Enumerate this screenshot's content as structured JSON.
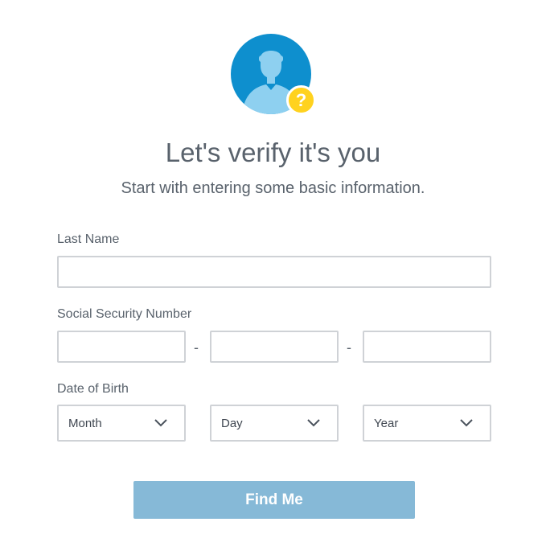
{
  "header": {
    "avatar_icon": "user-silhouette-icon",
    "help_badge": "?",
    "title": "Let's verify it's you",
    "subtitle": "Start with entering some basic information."
  },
  "form": {
    "last_name": {
      "label": "Last Name",
      "value": "",
      "placeholder": ""
    },
    "ssn": {
      "label": "Social Security Number",
      "separator": "-",
      "part1": "",
      "part2": "",
      "part3": ""
    },
    "dob": {
      "label": "Date of Birth",
      "month": "Month",
      "day": "Day",
      "year": "Year",
      "chevron_icon": "chevron-down-icon"
    },
    "submit_label": "Find Me"
  },
  "colors": {
    "avatar_bg": "#0e8fce",
    "avatar_figure": "#8ed0f0",
    "badge": "#ffd21f",
    "button_bg": "#86b9d7",
    "text": "#59626c",
    "input_border": "#cfd2d6"
  }
}
